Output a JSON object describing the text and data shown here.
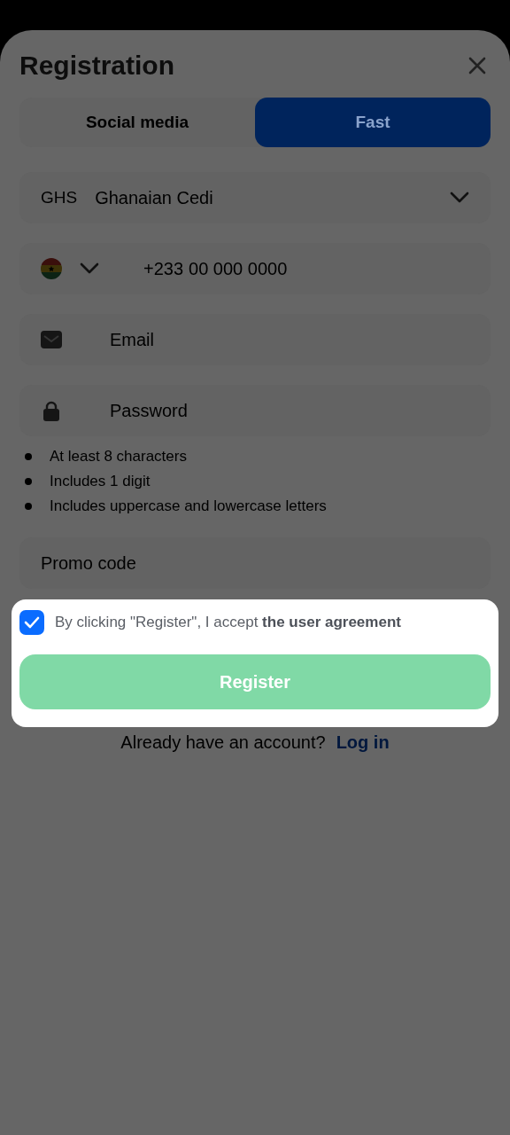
{
  "title": "Registration",
  "tabs": [
    {
      "label": "Social media",
      "selected": false
    },
    {
      "label": "Fast",
      "selected": true
    }
  ],
  "currency": {
    "code": "GHS",
    "name": "Ghanaian Cedi"
  },
  "phone": {
    "prefix": "+233",
    "placeholder": "00 000 0000"
  },
  "email": {
    "placeholder": "Email"
  },
  "password": {
    "placeholder": "Password"
  },
  "password_rules": [
    "At least 8 characters",
    "Includes 1 digit",
    "Includes uppercase and lowercase letters"
  ],
  "promo": {
    "placeholder": "Promo code"
  },
  "agreement": {
    "checked": true,
    "text": "By clicking \"Register\", I accept ",
    "link": "the user agreement"
  },
  "register_button": "Register",
  "login": {
    "prompt": "Already have an account?",
    "link": "Log in"
  }
}
